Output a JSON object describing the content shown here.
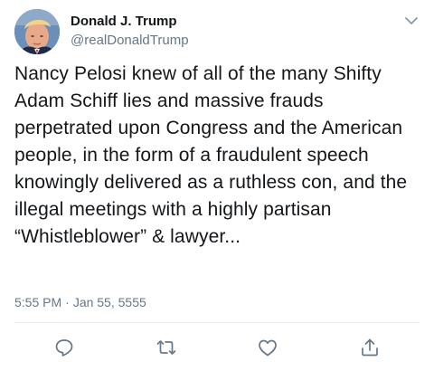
{
  "tweet": {
    "author": {
      "display_name": "Donald J. Trump",
      "handle": "@realDonaldTrump",
      "avatar_icon": "profile-photo"
    },
    "text": "Nancy Pelosi knew of all of the many Shifty Adam Schiff lies and massive frauds perpetrated upon Congress and the American people, in the form of a fraudulent speech knowingly delivered as a ruthless con, and the illegal meetings with a highly partisan “Whistleblower” & lawyer...",
    "time": "5:55 PM",
    "date": "Jan 55, 5555",
    "separator": "·"
  },
  "actions": {
    "reply_icon": "comment-icon",
    "retweet_icon": "retweet-icon",
    "like_icon": "heart-icon",
    "share_icon": "share-icon"
  },
  "colors": {
    "text": "#14171a",
    "secondary": "#657786",
    "divider": "#e6ecf0",
    "icon": "#657786"
  }
}
